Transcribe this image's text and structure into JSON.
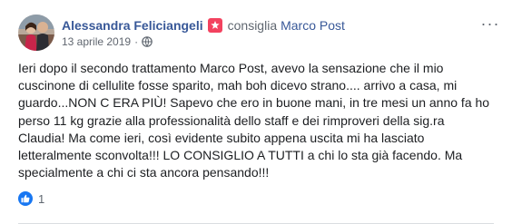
{
  "post": {
    "author": "Alessandra Feliciangeli",
    "action": "consiglia",
    "page": "Marco Post",
    "date": "13 aprile 2019",
    "separator": "·",
    "more_label": "···",
    "text": "Ieri dopo il secondo trattamento Marco Post, avevo la sensazione che il mio cuscinone di cellulite fosse sparito, mah boh dicevo strano.... arrivo a casa, mi guardo...NON C ERA PIÙ! Sapevo che ero in buone mani, in tre mesi un anno fa ho perso 11 kg grazie alla professionalità dello staff e dei rimproveri della sig.ra Claudia! Ma come ieri, così evidente subito appena uscita mi ha lasciato letteralmente sconvolta!!! LO CONSIGLIO A TUTTI a chi lo sta già facendo. Ma specialmente a chi ci sta ancora pensando!!!",
    "reaction_count": "1"
  },
  "icons": {
    "recommend": "recommend-flag-icon",
    "audience": "globe-icon",
    "reaction": "like-icon",
    "menu": "more-options-icon"
  },
  "colors": {
    "link_blue": "#385898",
    "recommend_pink": "#f3425f",
    "like_blue": "#1877f2"
  }
}
